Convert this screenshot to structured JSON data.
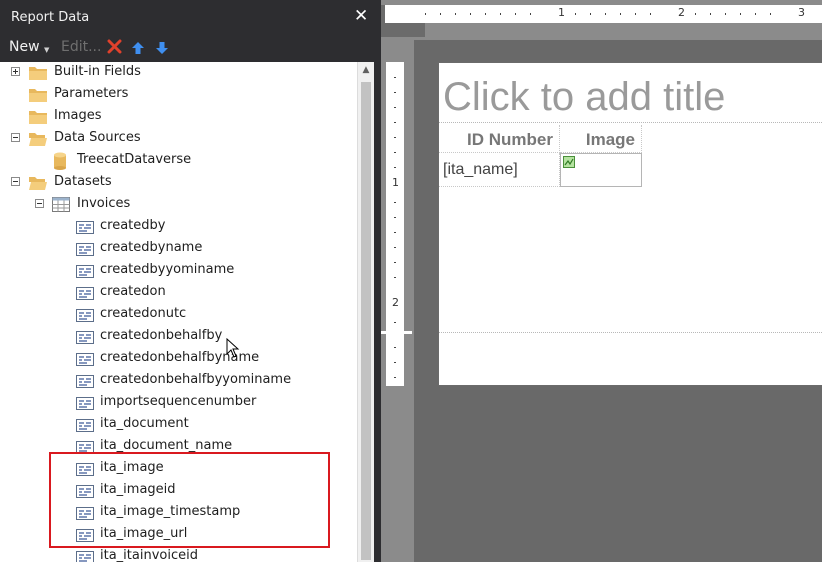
{
  "panel": {
    "title": "Report Data",
    "close_glyph": "✕",
    "toolbar": {
      "new_label": "New",
      "edit_label": "Edit...",
      "delete_icon": "red-x-icon",
      "move_up_icon": "blue-up-arrow-icon",
      "move_down_icon": "blue-down-arrow-icon"
    },
    "tree": {
      "builtin_fields": "Built-in Fields",
      "parameters": "Parameters",
      "images": "Images",
      "data_sources": "Data Sources",
      "data_source_item": "TreecatDataverse",
      "datasets": "Datasets",
      "dataset": "Invoices",
      "fields": [
        "createdby",
        "createdbyname",
        "createdbyyominame",
        "createdon",
        "createdonutc",
        "createdonbehalfby",
        "createdonbehalfbyname",
        "createdonbehalfbyyominame",
        "importsequencenumber",
        "ita_document",
        "ita_document_name",
        "ita_image",
        "ita_imageid",
        "ita_image_timestamp",
        "ita_image_url",
        "ita_itainvoiceid"
      ]
    },
    "highlighted_fields": [
      "ita_image",
      "ita_imageid",
      "ita_image_timestamp",
      "ita_image_url"
    ]
  },
  "ruler": {
    "h_labels": [
      "1",
      "2",
      "3"
    ],
    "v_labels": [
      "1",
      "2"
    ]
  },
  "report": {
    "title_placeholder": "Click to add title",
    "columns": [
      "ID Number",
      "Image"
    ],
    "row_expression": "[ita_name]"
  },
  "colors": {
    "panel_bg": "#2d2d30",
    "highlight_border": "#d9191f",
    "design_bg": "#8b8b8b"
  }
}
